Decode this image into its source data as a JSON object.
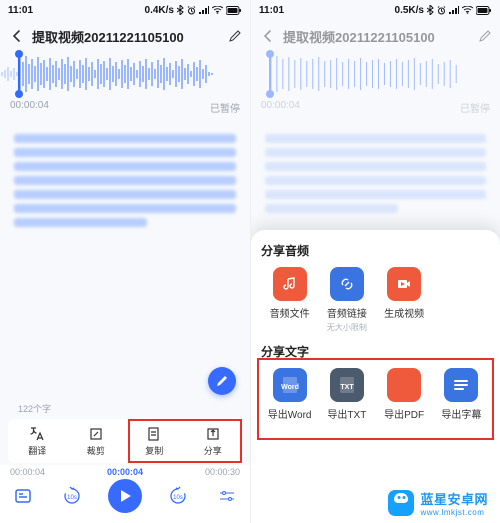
{
  "status": {
    "time": "11:01",
    "net": "0.4K/s",
    "net2": "0.5K/s"
  },
  "title": "提取视频20211221105100",
  "time": {
    "pos": "00:00:04",
    "state": "已暂停",
    "total": "00:00:30"
  },
  "count": "122个字",
  "tools": {
    "translate": "翻译",
    "crop": "裁剪",
    "copy": "复制",
    "share": "分享"
  },
  "play": {
    "left": "00:00:04",
    "mid": "00:00:04",
    "right": "00:00:30"
  },
  "sheet": {
    "audio_title": "分享音频",
    "audio": {
      "file": "音频文件",
      "link": "音频链接",
      "link_sub": "无大小限制",
      "video": "生成视频"
    },
    "text_title": "分享文字",
    "text": {
      "word": "导出Word",
      "txt": "导出TXT",
      "pdf": "导出PDF",
      "srt": "导出字幕"
    }
  },
  "watermark": {
    "name": "蓝星安卓网",
    "url": "www.lmkjst.com"
  },
  "colors": {
    "accent": "#376bff",
    "red": "#e4322b",
    "word": "#3a74e0",
    "txt": "#4c5a6d",
    "pdf": "#ef5a3c",
    "srt": "#3a74e0",
    "afile": "#ef5a3c",
    "alink": "#3a74e0",
    "avideo": "#ef5a3c"
  }
}
